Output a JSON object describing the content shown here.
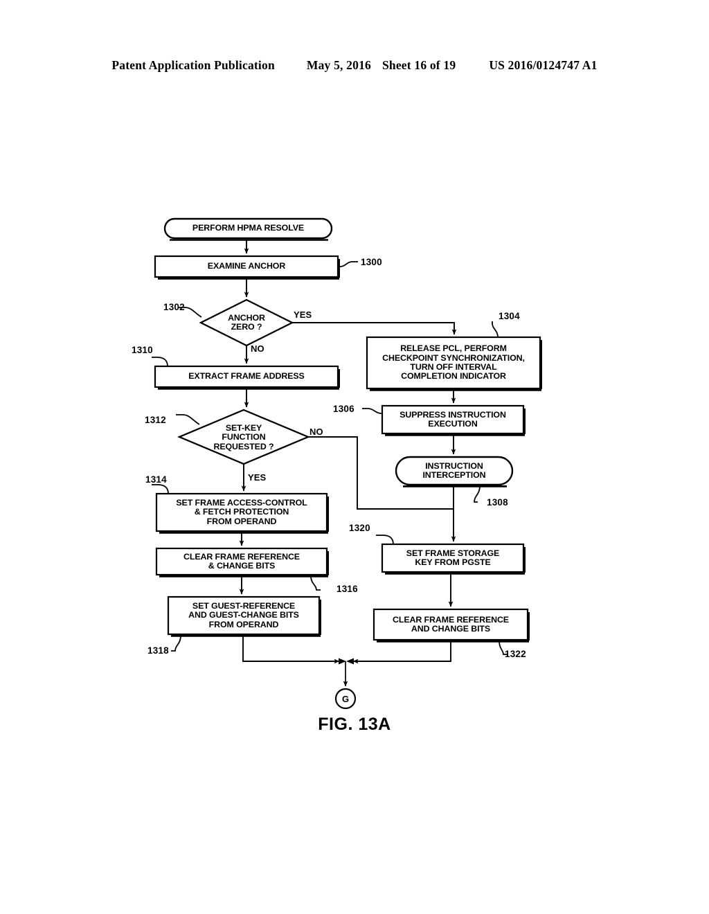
{
  "header": {
    "publication": "Patent Application Publication",
    "date": "May 5, 2016",
    "sheet": "Sheet 16 of 19",
    "patent_number": "US 2016/0124747 A1"
  },
  "figure": {
    "caption": "FIG. 13A",
    "connector_letter": "G"
  },
  "nodes": {
    "start": {
      "ref": "",
      "lines": [
        "PERFORM HPMA RESOLVE"
      ]
    },
    "examine_anchor": {
      "ref": "1300",
      "lines": [
        "EXAMINE ANCHOR"
      ]
    },
    "anchor_zero": {
      "ref": "1302",
      "lines": [
        "ANCHOR",
        "ZERO ?"
      ]
    },
    "release_pcl": {
      "ref": "1304",
      "lines": [
        "RELEASE PCL, PERFORM",
        "CHECKPOINT SYNCHRONIZATION,",
        "TURN OFF INTERVAL",
        "COMPLETION INDICATOR"
      ]
    },
    "suppress_instruction": {
      "ref": "1306",
      "lines": [
        "SUPPRESS INSTRUCTION",
        "EXECUTION"
      ]
    },
    "instruction_interception": {
      "ref": "1308",
      "lines": [
        "INSTRUCTION",
        "INTERCEPTION"
      ]
    },
    "extract_frame_address": {
      "ref": "1310",
      "lines": [
        "EXTRACT FRAME ADDRESS"
      ]
    },
    "set_key_function": {
      "ref": "1312",
      "lines": [
        "SET-KEY",
        "FUNCTION",
        "REQUESTED ?"
      ]
    },
    "set_frame_access_control": {
      "ref": "1314",
      "lines": [
        "SET FRAME ACCESS-CONTROL",
        "& FETCH PROTECTION",
        "FROM OPERAND"
      ]
    },
    "clear_frame_reference_left": {
      "ref": "1316",
      "lines": [
        "CLEAR FRAME REFERENCE",
        "& CHANGE BITS"
      ]
    },
    "set_guest_reference": {
      "ref": "1318",
      "lines": [
        "SET GUEST-REFERENCE",
        "AND GUEST-CHANGE BITS",
        "FROM OPERAND"
      ]
    },
    "set_frame_storage_key": {
      "ref": "1320",
      "lines": [
        "SET FRAME STORAGE",
        "KEY FROM PGSTE"
      ]
    },
    "clear_frame_reference_right": {
      "ref": "1322",
      "lines": [
        "CLEAR FRAME REFERENCE",
        "AND CHANGE BITS"
      ]
    }
  },
  "edge_labels": {
    "anchor_zero_yes": "YES",
    "anchor_zero_no": "NO",
    "set_key_no": "NO",
    "set_key_yes": "YES"
  },
  "colors": {
    "ink": "#000000",
    "paper": "#ffffff"
  }
}
